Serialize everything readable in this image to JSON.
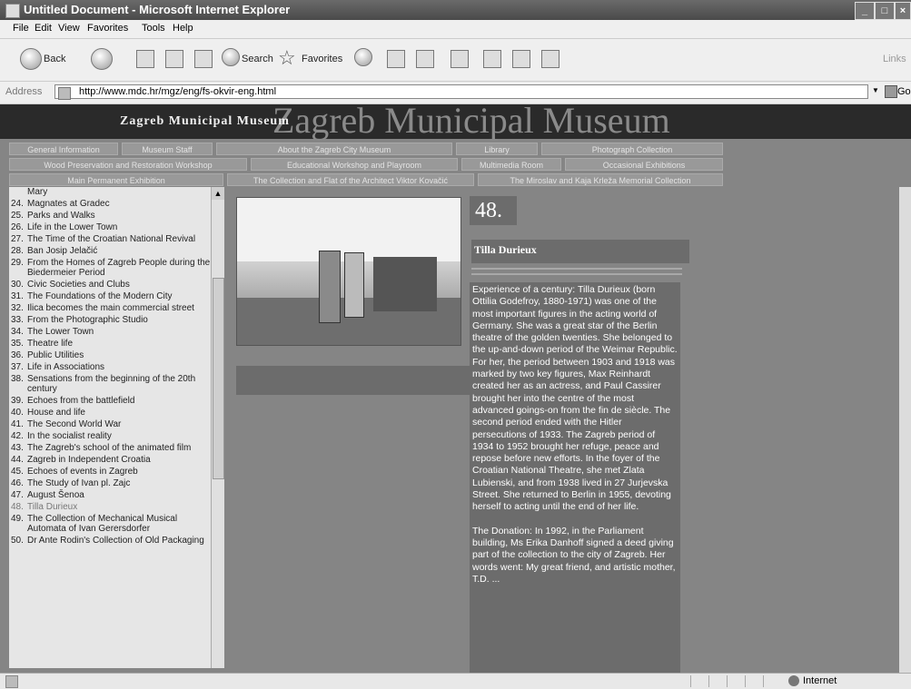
{
  "window": {
    "title": "Untitled Document - Microsoft Internet Explorer"
  },
  "menu": [
    "File",
    "Edit",
    "View",
    "Favorites",
    "Tools",
    "Help"
  ],
  "toolbar": {
    "back": "Back",
    "search": "Search",
    "favorites": "Favorites",
    "links": "Links"
  },
  "address": {
    "label": "Address",
    "url": "http://www.mdc.hr/mgz/eng/fs-okvir-eng.html",
    "go": "Go"
  },
  "banner": {
    "small_title": "Zagreb Municipal Museum",
    "big_title": "Zagreb Municipal Museum"
  },
  "nav": {
    "row1": [
      "General Information",
      "Museum Staff",
      "About the Zagreb City Museum",
      "Library",
      "Photograph Collection"
    ],
    "row2": [
      "Wood Preservation and Restoration Workshop",
      "Educational Workshop and Playroom",
      "Multimedia Room",
      "Occasional Exhibitions"
    ],
    "row3": [
      "Main Permanent Exhibition",
      "The Collection and Flat of the Architect Viktor Kovačić",
      "The Miroslav and Kaja Krleža Memorial Collection"
    ]
  },
  "sidebar": {
    "partial_top": "Mary",
    "items": [
      {
        "num": "24.",
        "text": "Magnates at Gradec"
      },
      {
        "num": "25.",
        "text": "Parks and Walks"
      },
      {
        "num": "26.",
        "text": "Life in the Lower Town"
      },
      {
        "num": "27.",
        "text": "The Time of the Croatian National Revival"
      },
      {
        "num": "28.",
        "text": "Ban Josip Jelačić"
      },
      {
        "num": "29.",
        "text": "From the Homes of Zagreb People during the Biedermeier Period"
      },
      {
        "num": "30.",
        "text": "Civic Societies and Clubs"
      },
      {
        "num": "31.",
        "text": "The Foundations of the Modern City"
      },
      {
        "num": "32.",
        "text": "Ilica becomes the main commercial street"
      },
      {
        "num": "33.",
        "text": "From the Photographic Studio"
      },
      {
        "num": "34.",
        "text": "The Lower Town"
      },
      {
        "num": "35.",
        "text": "Theatre life"
      },
      {
        "num": "36.",
        "text": "Public Utilities"
      },
      {
        "num": "37.",
        "text": "Life in Associations"
      },
      {
        "num": "38.",
        "text": "Sensations from the beginning of the 20th century"
      },
      {
        "num": "39.",
        "text": "Echoes from the battlefield"
      },
      {
        "num": "40.",
        "text": "House and life"
      },
      {
        "num": "41.",
        "text": "The Second World War"
      },
      {
        "num": "42.",
        "text": "In the socialist reality"
      },
      {
        "num": "43.",
        "text": "The Zagreb's school of the animated film"
      },
      {
        "num": "44.",
        "text": "Zagreb in Independent Croatia"
      },
      {
        "num": "45.",
        "text": "Echoes of events in Zagreb"
      },
      {
        "num": "46.",
        "text": "The Study of Ivan pl. Zajc"
      },
      {
        "num": "47.",
        "text": "August Šenoa"
      },
      {
        "num": "48.",
        "text": "Tilla Durieux",
        "current": true
      },
      {
        "num": "49.",
        "text": "The Collection of Mechanical Musical Automata of Ivan Gerersdorfer"
      },
      {
        "num": "50.",
        "text": "Dr Ante Rodin's Collection of Old Packaging"
      }
    ]
  },
  "content": {
    "number": "48.",
    "name": "Tilla Durieux",
    "paragraphs": [
      "Experience of a century: Tilla Durieux (born Ottilia Godefroy, 1880-1971) was one of the most important figures in the acting world of Germany. She was a great star of the Berlin theatre of the golden twenties. She belonged to the up-and-down period of the Weimar Republic. For her, the period between 1903 and 1918 was marked by two key figures, Max Reinhardt created her as an actress, and Paul Cassirer brought her into the centre of the most advanced goings-on from the fin de siècle. The second period ended with the Hitler persecutions of 1933. The Zagreb period of 1934 to 1952 brought her refuge, peace and repose before new efforts. In the foyer of the Croatian National Theatre, she met Zlata Lubienski, and from 1938 lived in 27 Jurjevska Street. She returned to Berlin in 1955, devoting herself to acting until the end of her life.",
      "The Donation: In 1992, in the Parliament building, Ms Erika Danhoff signed a deed giving part of the collection to the city of Zagreb. Her words went: My great friend, and artistic mother, T.D. ..."
    ]
  },
  "status": {
    "zone": "Internet"
  }
}
